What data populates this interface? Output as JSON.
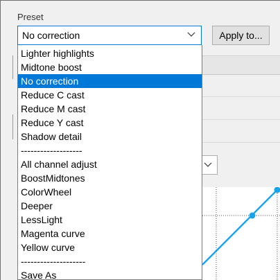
{
  "preset": {
    "label": "Preset",
    "selected_value": "No correction",
    "apply_button_label": "Apply to...",
    "options": [
      "Lighter highlights",
      "Midtone boost",
      "No correction",
      "Reduce C cast",
      "Reduce M cast",
      "Reduce Y cast",
      "Shadow detail",
      "-------------------",
      "All channel adjust",
      "BoostMidtones",
      "ColorWheel",
      "Deeper",
      "LessLight",
      "Magenta curve",
      "Yellow curve",
      "--------------------",
      "Save As"
    ],
    "selected_index": 2
  },
  "colors": {
    "selection_bg": "#0078d7",
    "curve_line": "#1aa3e8",
    "combo_focus_border": "#0078d7"
  },
  "icons": {
    "combo_chevron": "chevron-down-icon"
  }
}
